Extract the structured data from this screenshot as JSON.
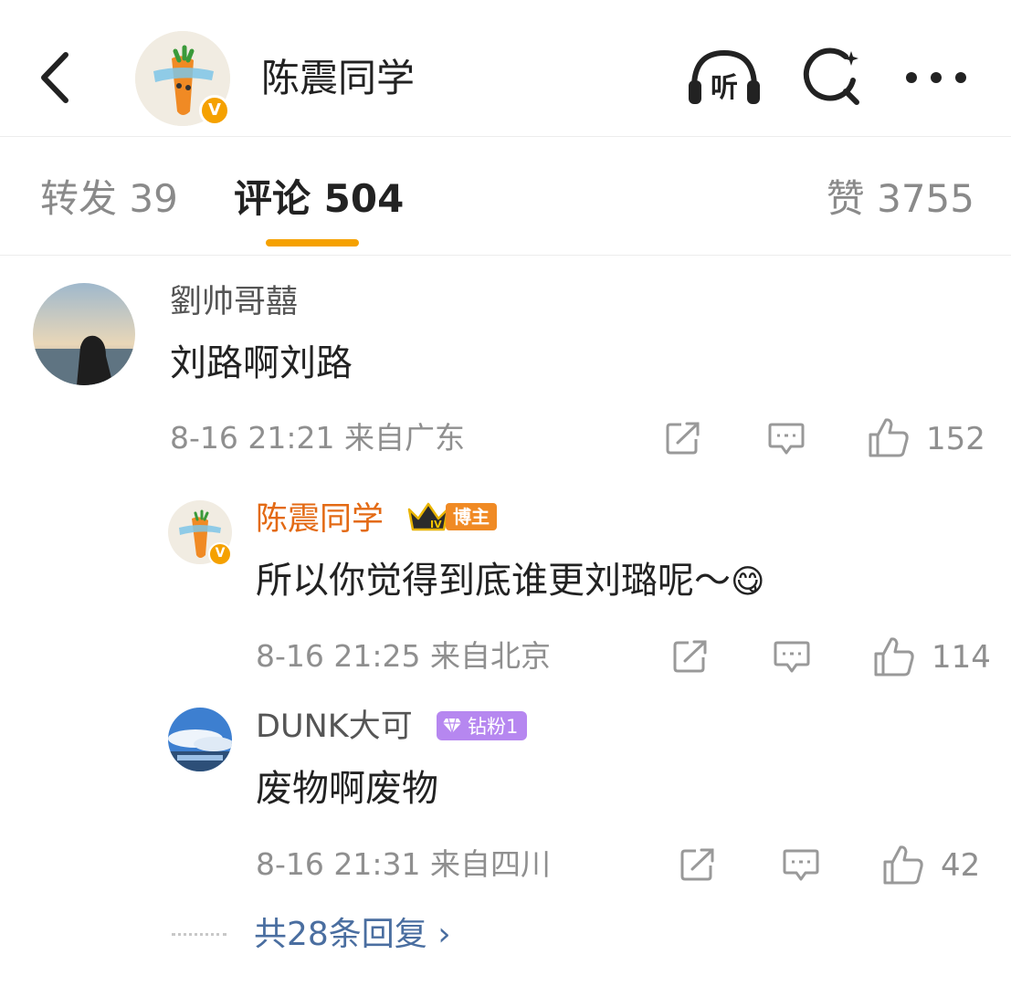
{
  "header": {
    "title": "陈震同学",
    "icons": [
      "back-icon",
      "listen-icon",
      "search-icon",
      "more-icon"
    ],
    "listen_label": "听"
  },
  "tabs": {
    "repost": "转发 39",
    "comment": "评论 504",
    "like": "赞 3755"
  },
  "comments": [
    {
      "user": "劉帅哥囍",
      "text": "刘路啊刘路",
      "time": "8-16 21:21",
      "location": "来自广东",
      "likes": "152"
    }
  ],
  "replies": [
    {
      "user": "陈震同学",
      "badge": "博主",
      "crown_level": "IV",
      "text": "所以你觉得到底谁更刘璐呢～",
      "emoji": "😋",
      "time": "8-16 21:25",
      "location": "来自北京",
      "likes": "114"
    },
    {
      "user": "DUNK大可",
      "badge": "钻粉1",
      "text": "废物啊废物",
      "time": "8-16 21:31",
      "location": "来自四川",
      "likes": "42"
    }
  ],
  "more_replies": "共28条回复 ›",
  "verified_mark": "V",
  "colors": {
    "accent": "#f5a100",
    "host_name": "#e36a14",
    "link": "#4a6ea0",
    "diamond_badge": "#b687f0"
  }
}
